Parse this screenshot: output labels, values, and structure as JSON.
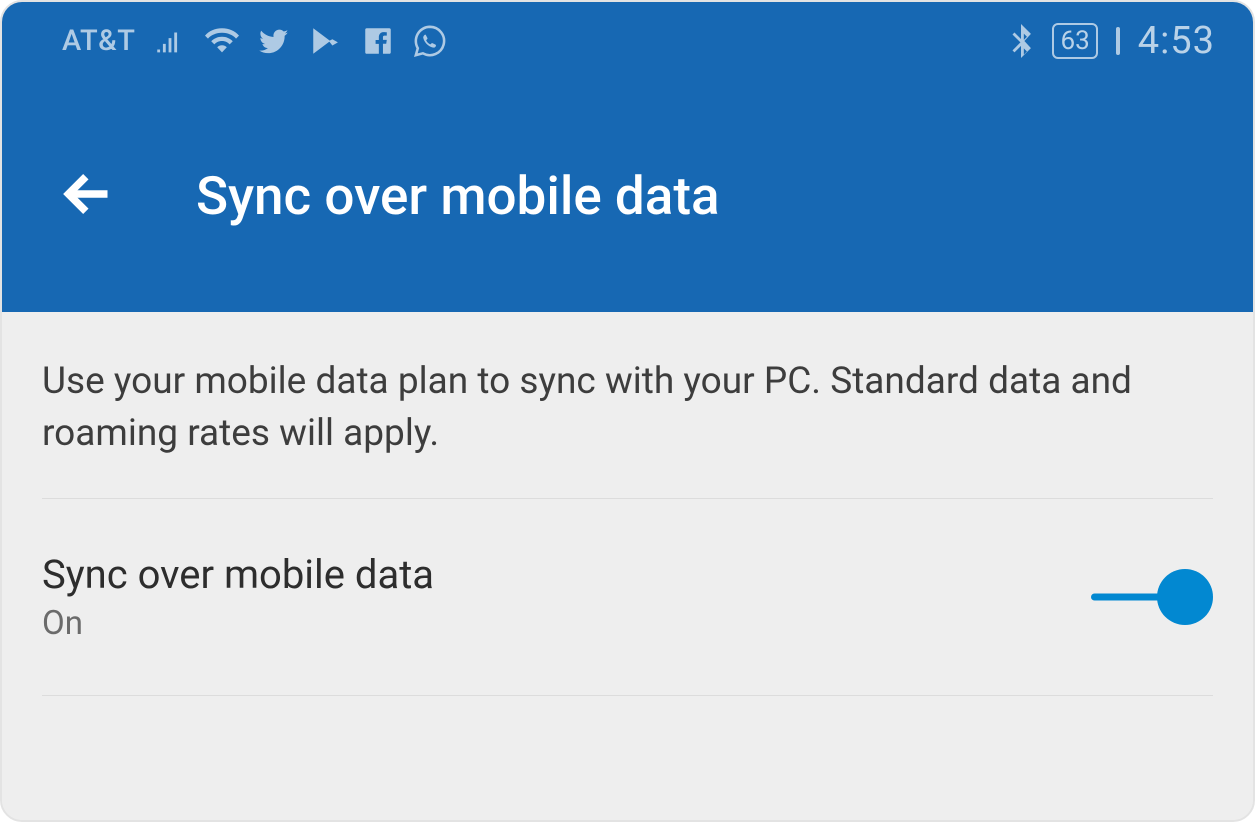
{
  "status_bar": {
    "carrier": "AT&T",
    "battery_level": "63",
    "time": "4:53"
  },
  "header": {
    "title": "Sync over mobile data"
  },
  "content": {
    "description": "Use your mobile data plan to sync with your PC. Standard data and roaming rates will apply.",
    "setting": {
      "label": "Sync over mobile data",
      "status": "On"
    }
  }
}
